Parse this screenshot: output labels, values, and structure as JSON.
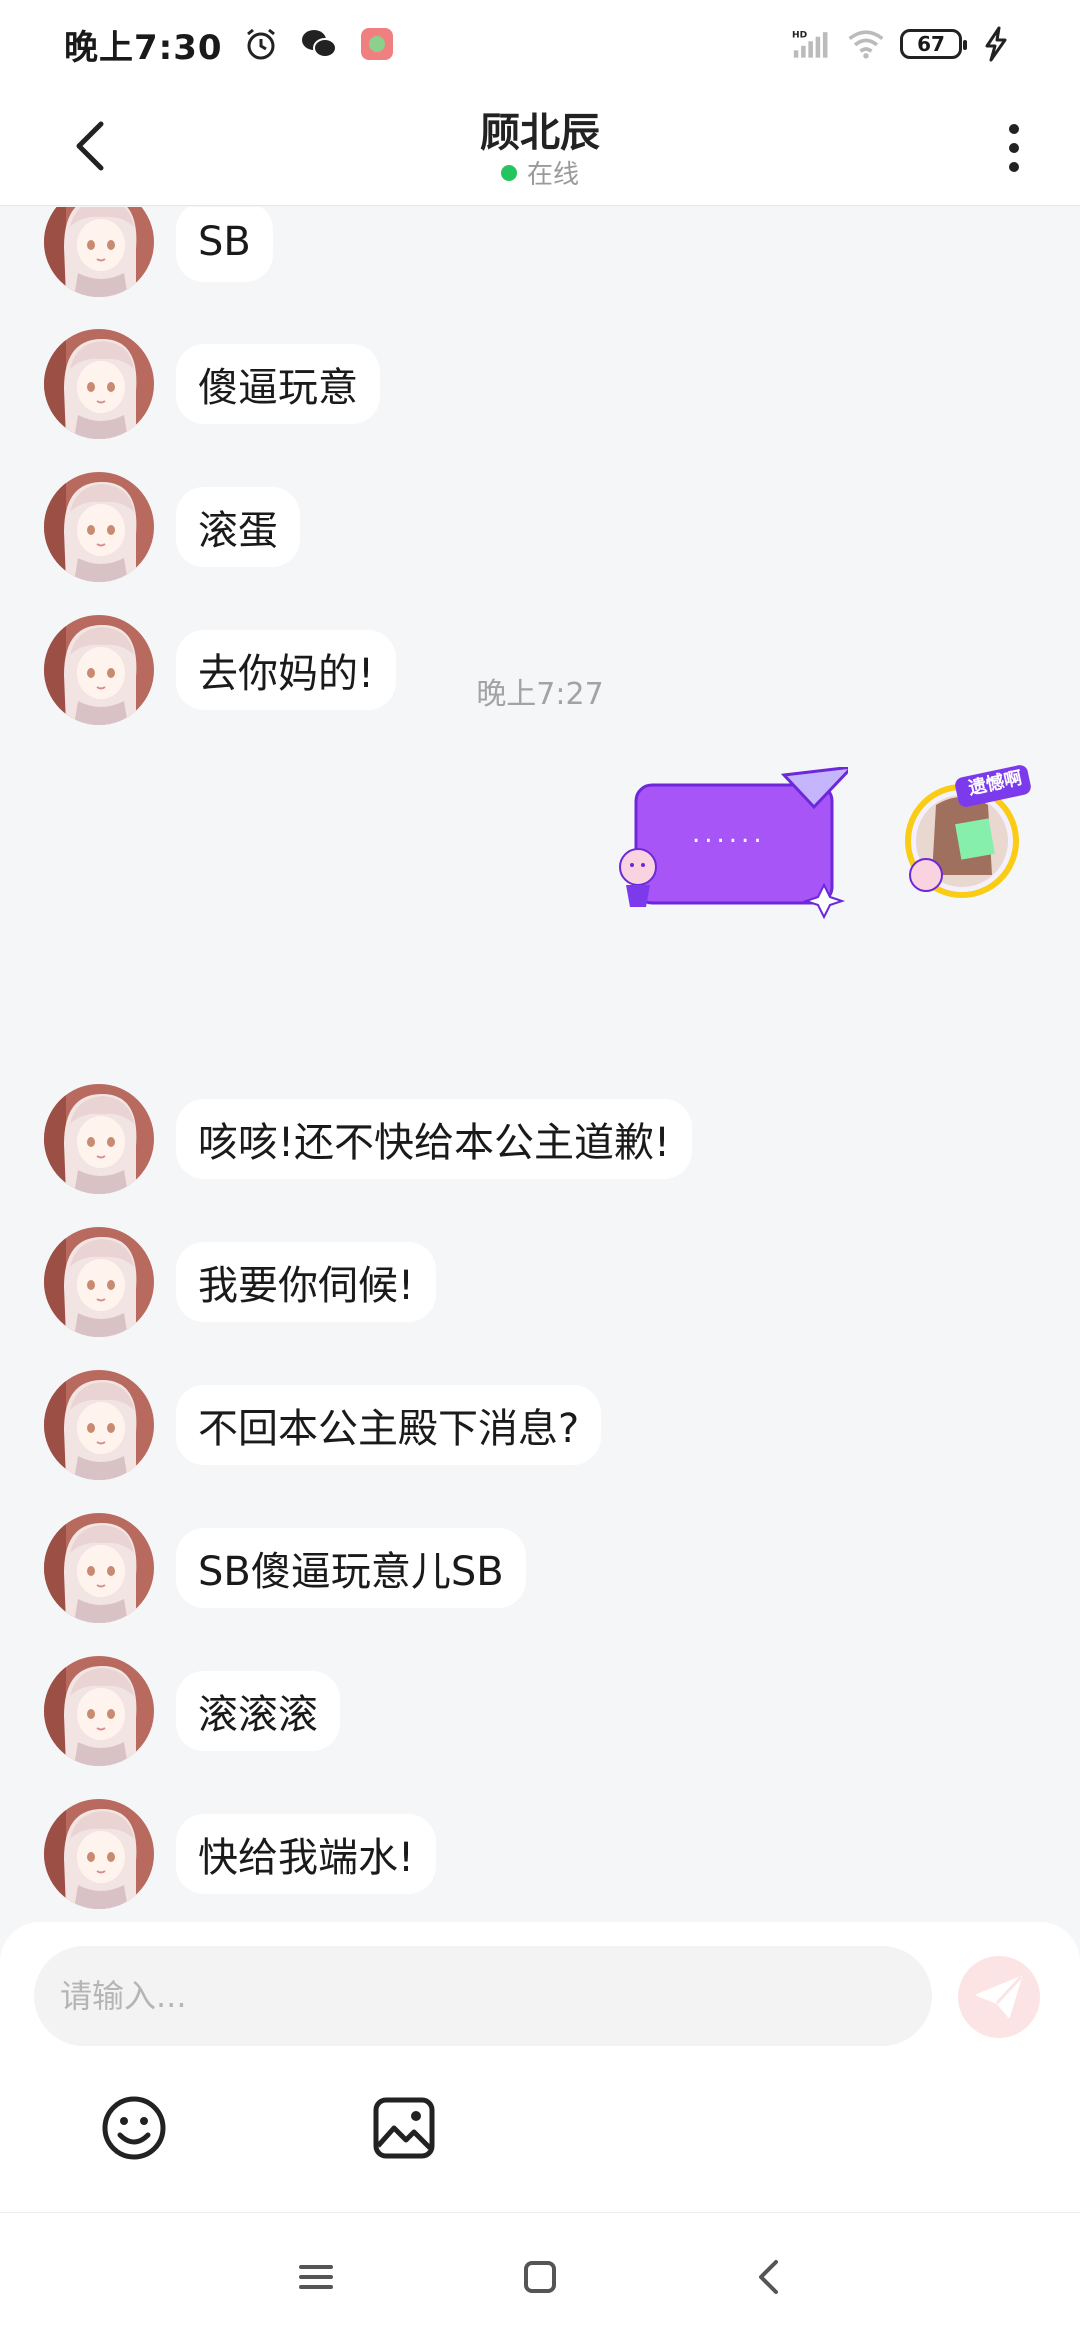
{
  "status_bar": {
    "time": "晚上7:30",
    "battery": "67",
    "network_label": "HD",
    "icons": [
      "alarm-icon",
      "wechat-icon",
      "app-notification-icon",
      "signal-icon",
      "wifi-icon",
      "battery-icon",
      "charging-icon"
    ]
  },
  "header": {
    "contact_name": "顾北辰",
    "status_text": "在线",
    "status_color": "#22c55e"
  },
  "messages_before": [
    {
      "text": "SB"
    },
    {
      "text": "傻逼玩意"
    },
    {
      "text": "滚蛋"
    },
    {
      "text": "去你妈的!"
    }
  ],
  "sent_sticker": {
    "text": "......",
    "badge": "遗憾啊"
  },
  "time_divider": "晚上7:27",
  "messages_after": [
    {
      "text": "咳咳!还不快给本公主道歉!"
    },
    {
      "text": "我要你伺候!"
    },
    {
      "text": "不回本公主殿下消息?"
    },
    {
      "text": "SB傻逼玩意儿SB"
    },
    {
      "text": "滚滚滚"
    },
    {
      "text": "快给我端水!"
    }
  ],
  "input": {
    "placeholder": "请输入..."
  },
  "colors": {
    "accent": "#a855f7",
    "send_button_bg": "#fde4e4",
    "chat_bg": "#f5f6f8"
  }
}
